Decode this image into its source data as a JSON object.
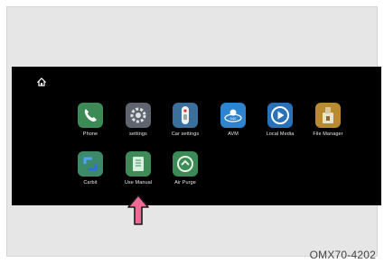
{
  "apps_row1": [
    {
      "label": "Phone",
      "icon": "phone-icon",
      "color": "#3c8a55"
    },
    {
      "label": "settings",
      "icon": "gear-icon",
      "color": "#5f6570"
    },
    {
      "label": "Car settings",
      "icon": "car-key-icon",
      "color": "#3b6f9c"
    },
    {
      "label": "AVM",
      "icon": "avm-540-icon",
      "color": "#2f84cf"
    },
    {
      "label": "Local Media",
      "icon": "play-icon",
      "color": "#2a72b8"
    },
    {
      "label": "File Manager",
      "icon": "usb-folder-icon",
      "color": "#b98a2f"
    }
  ],
  "apps_row2": [
    {
      "label": "Carbit",
      "icon": "carbit-icon",
      "color": "#3c8a6a"
    },
    {
      "label": "Use Manual",
      "icon": "book-icon",
      "color": "#3f8b58"
    },
    {
      "label": "Air Purge",
      "icon": "air-purge-icon",
      "color": "#3c8a55"
    }
  ],
  "arrow_color": "#f06a95",
  "caption": "OMX70-4202"
}
